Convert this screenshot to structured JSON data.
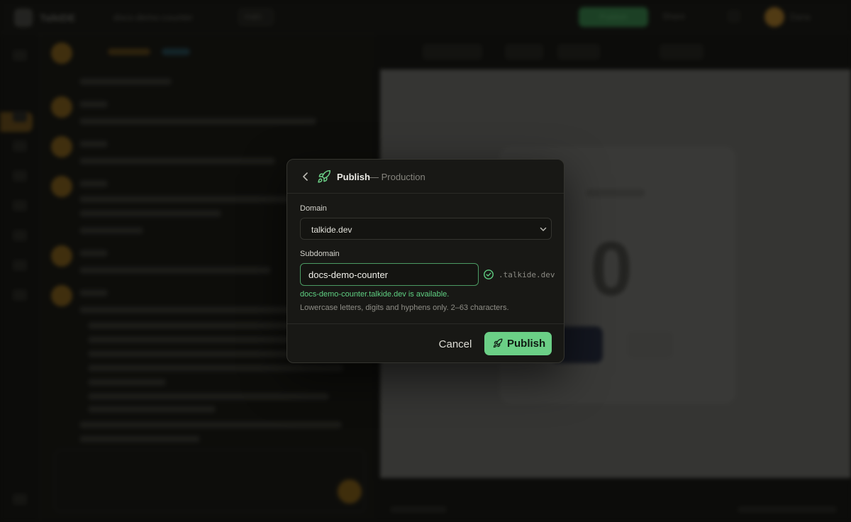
{
  "background": {
    "app_name": "TalkIDE",
    "project_name": "docs-demo-counter",
    "branch": "main",
    "top_publish_label": "Publish",
    "share_label": "Share",
    "user_label": "Dana",
    "counter_value": "0"
  },
  "modal": {
    "title": "Publish",
    "subtitle": "— Production",
    "domain_label": "Domain",
    "domain_value": "talkide.dev",
    "subdomain_label": "Subdomain",
    "subdomain_value": "docs-demo-counter",
    "suffix": ".talkide.dev",
    "availability": "docs-demo-counter.talkide.dev is available.",
    "hint": "Lowercase letters, digits and hyphens only. 2–63 characters.",
    "cancel_label": "Cancel",
    "publish_label": "Publish"
  },
  "colors": {
    "accent_green": "#6bcf86",
    "success_text": "#5fcf82",
    "modal_bg": "#181815"
  },
  "icons": {
    "back": "chevron-left-icon",
    "title": "rocket-icon",
    "select": "chevron-down-icon",
    "status": "check-circle-icon"
  }
}
